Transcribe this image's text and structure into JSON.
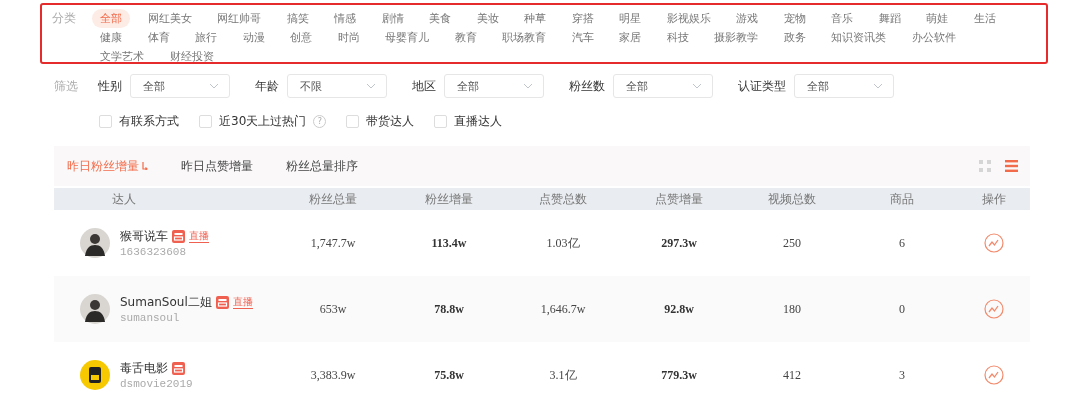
{
  "categories": {
    "label": "分类",
    "items": [
      {
        "label": "全部",
        "selected": true
      },
      {
        "label": "网红美女",
        "selected": false
      },
      {
        "label": "网红帅哥",
        "selected": false
      },
      {
        "label": "搞笑",
        "selected": false
      },
      {
        "label": "情感",
        "selected": false
      },
      {
        "label": "剧情",
        "selected": false
      },
      {
        "label": "美食",
        "selected": false
      },
      {
        "label": "美妆",
        "selected": false
      },
      {
        "label": "种草",
        "selected": false
      },
      {
        "label": "穿搭",
        "selected": false
      },
      {
        "label": "明星",
        "selected": false
      },
      {
        "label": "影视娱乐",
        "selected": false
      },
      {
        "label": "游戏",
        "selected": false
      },
      {
        "label": "宠物",
        "selected": false
      },
      {
        "label": "音乐",
        "selected": false
      },
      {
        "label": "舞蹈",
        "selected": false
      },
      {
        "label": "萌娃",
        "selected": false
      },
      {
        "label": "生活",
        "selected": false
      },
      {
        "label": "健康",
        "selected": false
      },
      {
        "label": "体育",
        "selected": false
      },
      {
        "label": "旅行",
        "selected": false
      },
      {
        "label": "动漫",
        "selected": false
      },
      {
        "label": "创意",
        "selected": false
      },
      {
        "label": "时尚",
        "selected": false
      },
      {
        "label": "母婴育儿",
        "selected": false
      },
      {
        "label": "教育",
        "selected": false
      },
      {
        "label": "职场教育",
        "selected": false
      },
      {
        "label": "汽车",
        "selected": false
      },
      {
        "label": "家居",
        "selected": false
      },
      {
        "label": "科技",
        "selected": false
      },
      {
        "label": "摄影教学",
        "selected": false
      },
      {
        "label": "政务",
        "selected": false
      },
      {
        "label": "知识资讯类",
        "selected": false
      },
      {
        "label": "办公软件",
        "selected": false
      },
      {
        "label": "文学艺术",
        "selected": false
      },
      {
        "label": "财经投资",
        "selected": false
      }
    ]
  },
  "filters": {
    "label": "筛选",
    "selects": [
      {
        "label": "性别",
        "value": "全部"
      },
      {
        "label": "年龄",
        "value": "不限"
      },
      {
        "label": "地区",
        "value": "全部"
      },
      {
        "label": "粉丝数",
        "value": "全部"
      },
      {
        "label": "认证类型",
        "value": "全部"
      }
    ],
    "checkboxes": [
      {
        "label": "有联系方式",
        "checked": false
      },
      {
        "label": "近30天上过热门",
        "checked": false,
        "help_mark": "?"
      },
      {
        "label": "带货达人",
        "checked": false
      },
      {
        "label": "直播达人",
        "checked": false
      }
    ]
  },
  "sort_tabs": [
    {
      "label": "昨日粉丝增量",
      "selected": true
    },
    {
      "label": "昨日点赞增量",
      "selected": false
    },
    {
      "label": "粉丝总量排序",
      "selected": false
    }
  ],
  "views": [
    {
      "kind": "grid",
      "selected": false
    },
    {
      "kind": "list",
      "selected": true
    }
  ],
  "table": {
    "columns": [
      "达人",
      "粉丝总量",
      "粉丝增量",
      "点赞总数",
      "点赞增量",
      "视频总数",
      "商品",
      "操作"
    ],
    "rows": [
      {
        "kind": "person",
        "name": "猴哥说车",
        "id": "1636323608",
        "shop_badge": true,
        "live_badge": "直播",
        "fans_total": "1,747.7w",
        "fans_gain": "113.4w",
        "likes_total": "1.03亿",
        "likes_gain": "297.3w",
        "videos": "250",
        "products": "6"
      },
      {
        "kind": "person",
        "name": "SumanSoul二姐",
        "id": "sumansoul",
        "shop_badge": true,
        "live_badge": "直播",
        "fans_total": "653w",
        "fans_gain": "78.8w",
        "likes_total": "1,646.7w",
        "likes_gain": "92.8w",
        "videos": "180",
        "products": "0"
      },
      {
        "kind": "logo",
        "name": "毒舌电影",
        "id": "dsmovie2019",
        "shop_badge": true,
        "fans_total": "3,383.9w",
        "fans_gain": "75.8w",
        "likes_total": "3.1亿",
        "likes_gain": "779.3w",
        "videos": "412",
        "products": "3"
      }
    ]
  }
}
